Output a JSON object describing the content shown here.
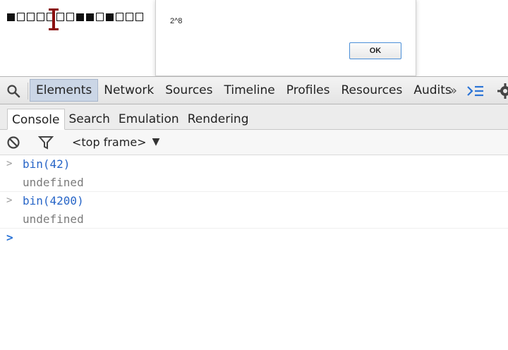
{
  "page": {
    "glyphs": [
      "filled",
      "empty",
      "empty",
      "empty",
      "empty",
      "empty",
      "empty",
      "filled",
      "filled",
      "empty",
      "filled",
      "empty",
      "empty",
      "empty"
    ]
  },
  "alert": {
    "message": "2^8",
    "ok_label": "OK"
  },
  "devtools": {
    "main_tabs": [
      {
        "label": "Elements",
        "active": true
      },
      {
        "label": "Network",
        "active": false
      },
      {
        "label": "Sources",
        "active": false
      },
      {
        "label": "Timeline",
        "active": false
      },
      {
        "label": "Profiles",
        "active": false
      },
      {
        "label": "Resources",
        "active": false
      },
      {
        "label": "Audits",
        "active": false
      }
    ],
    "overflow_label": "»",
    "icons": {
      "search": "magnifier-icon",
      "drawer": "console-drawer-icon",
      "settings": "gear-icon",
      "clear": "clear-console-icon",
      "filter": "filter-icon"
    },
    "drawer_tabs": [
      {
        "label": "Console",
        "active": true
      },
      {
        "label": "Search",
        "active": false
      },
      {
        "label": "Emulation",
        "active": false
      },
      {
        "label": "Rendering",
        "active": false
      }
    ],
    "frame_selector": "<top frame>",
    "accent_color": "#2765c7"
  },
  "console": {
    "messages": [
      {
        "command": "bin(42)",
        "result": "undefined"
      },
      {
        "command": "bin(4200)",
        "result": "undefined"
      }
    ]
  }
}
